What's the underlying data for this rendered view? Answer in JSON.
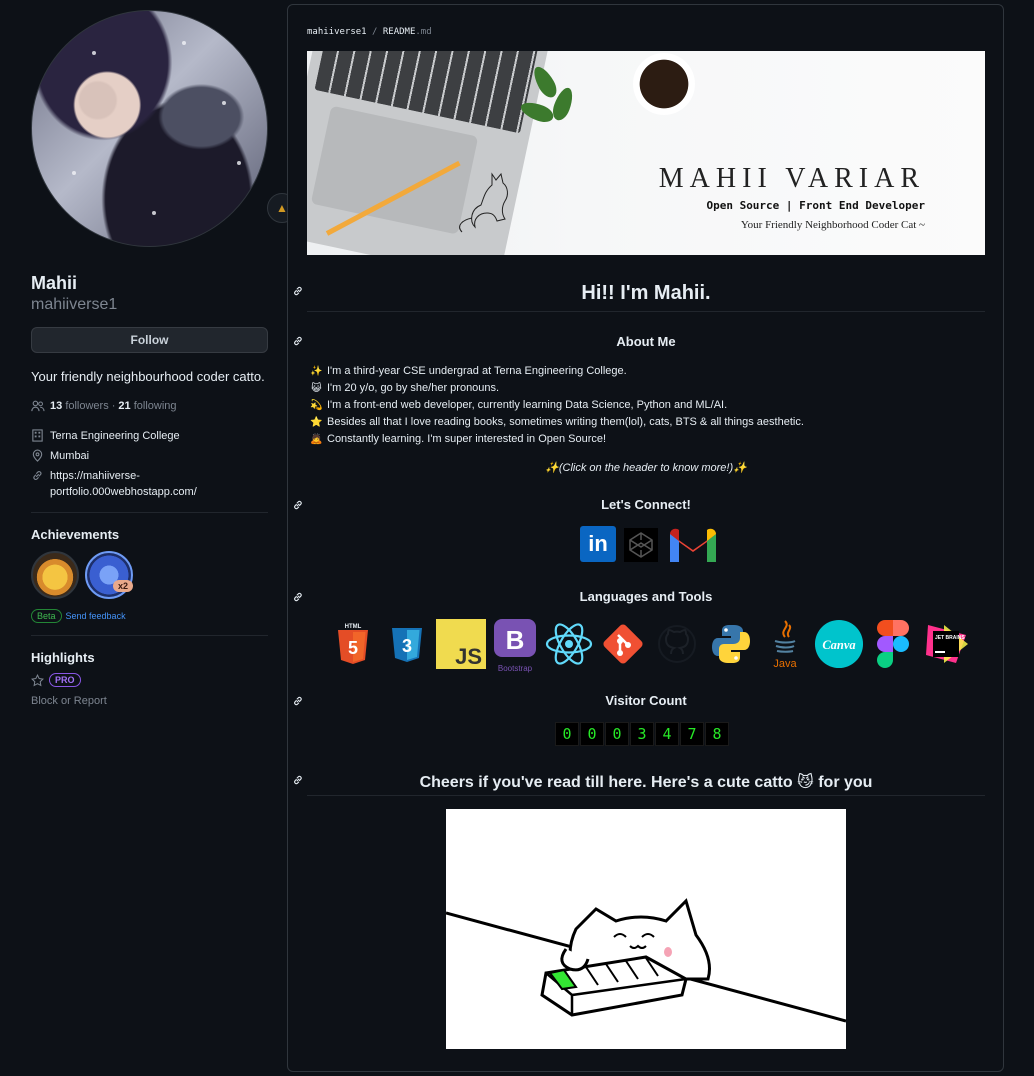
{
  "profile": {
    "name": "Mahii",
    "login": "mahiiverse1",
    "follow_label": "Follow",
    "bio": "Your friendly neighbourhood coder catto.",
    "followers_count": "13",
    "followers_label": "followers",
    "following_count": "21",
    "following_label": "following",
    "separator": "·",
    "organization": "Terna Engineering College",
    "location": "Mumbai",
    "website_line1": "https://mahiiverse-",
    "website_line2": "portfolio.000webhostapp.com/",
    "achievements_title": "Achievements",
    "achievement_multiplier": "x2",
    "beta_label": "Beta",
    "feedback_label": "Send feedback",
    "highlights_title": "Highlights",
    "pro_label": "PRO",
    "block_label": "Block or Report"
  },
  "readme": {
    "crumb_user": "mahiiverse1",
    "crumb_sep": "/",
    "crumb_file": "README",
    "crumb_ext": ".md",
    "banner_title": "MAHII VARIAR",
    "banner_subtitle": "Open Source | Front End Developer",
    "banner_tagline": "Your Friendly Neighborhood Coder Cat ~",
    "greeting": "Hi!! I'm Mahii.",
    "about_title": "About Me",
    "about_items": [
      {
        "emoji": "✨",
        "text": "I'm a third-year CSE undergrad at Terna Engineering College."
      },
      {
        "emoji": "😺",
        "text": "I'm 20 y/o, go by she/her pronouns."
      },
      {
        "emoji": "💫",
        "text": "I'm a front-end web developer, currently learning Data Science, Python and ML/AI."
      },
      {
        "emoji": "⭐",
        "text": "Besides all that I love reading books, sometimes writing them(lol), cats, BTS & all things aesthetic."
      },
      {
        "emoji": "🙇",
        "text": "Constantly learning. I'm super interested in Open Source!"
      }
    ],
    "click_note": "✨(Click on the header to know more!)✨",
    "connect_title": "Let's Connect!",
    "connect_linkedin": "in",
    "tools_title": "Languages and Tools",
    "tools": [
      "html5-icon",
      "css3-icon",
      "javascript-icon",
      "bootstrap-icon",
      "react-icon",
      "git-icon",
      "github-icon",
      "python-icon",
      "java-icon",
      "canva-icon",
      "figma-icon",
      "jetbrains-icon"
    ],
    "html5_tag": "HTML",
    "html5_num": "5",
    "css3_num": "3",
    "js_label": "JS",
    "bootstrap_letter": "B",
    "bootstrap_label": "Bootstrap",
    "java_label": "Java",
    "canva_label": "Canva",
    "jetbrains_label": "JET BRAINS",
    "visitor_title": "Visitor Count",
    "visitor_digits": [
      "0",
      "0",
      "0",
      "3",
      "4",
      "7",
      "8"
    ],
    "cheers": "Cheers if you've read till here. Here's a cute catto 😼 for you"
  },
  "colors": {
    "background": "#0d1117",
    "accent_link": "#4493f8",
    "beta_green": "#3fb950",
    "pro_purple": "#a371f7",
    "counter_green": "#27e827"
  }
}
